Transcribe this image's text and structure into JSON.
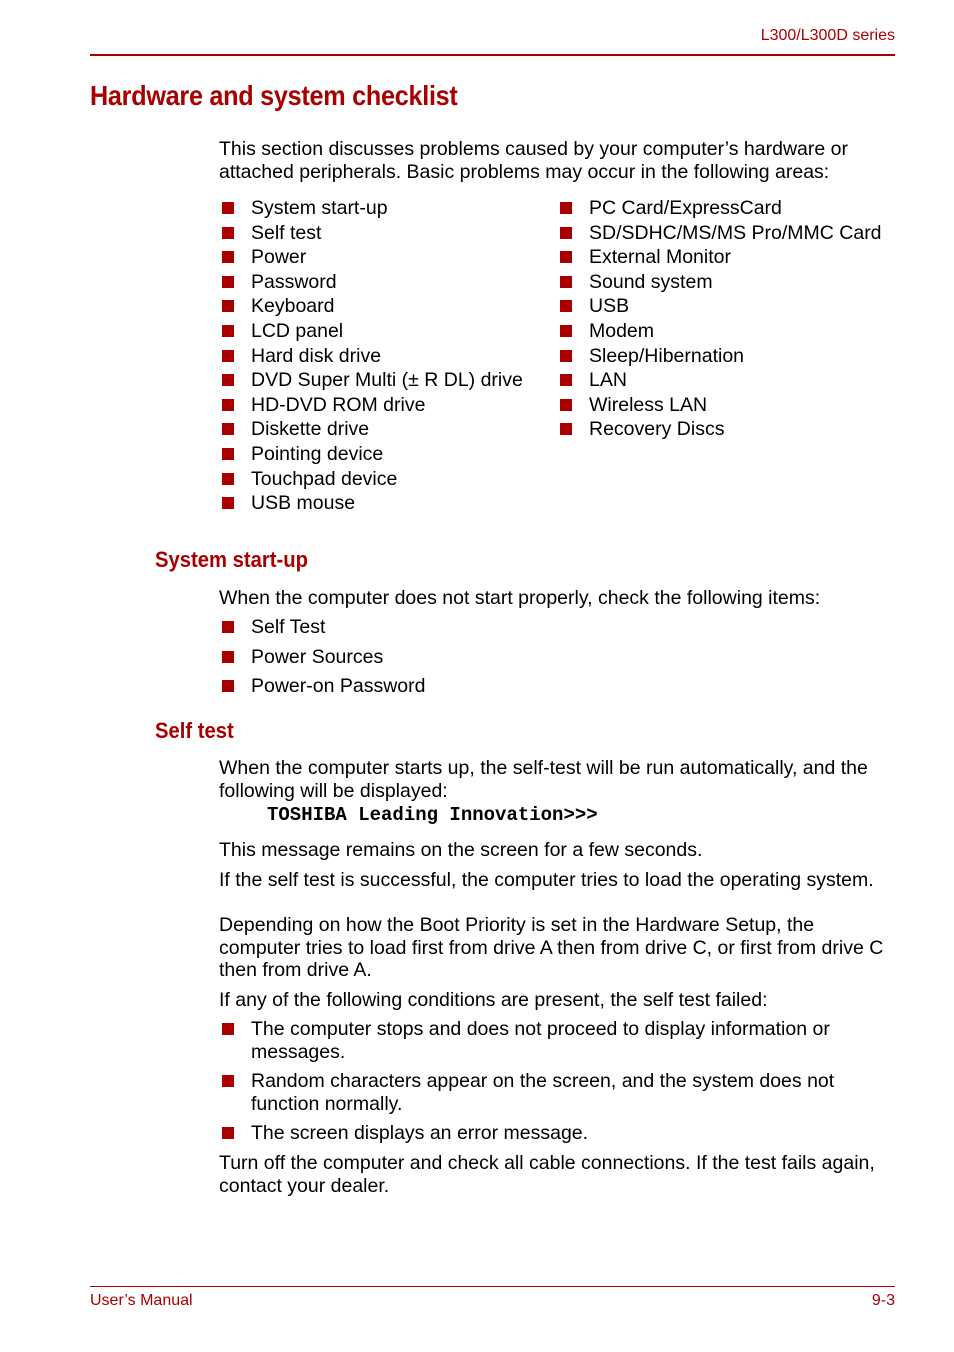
{
  "header": {
    "series": "L300/L300D series"
  },
  "title": "Hardware and system checklist",
  "intro": "This section discusses problems caused by your computer’s hardware or attached peripherals. Basic problems may occur in the following areas:",
  "areas_left": [
    "System start-up",
    "Self test",
    "Power",
    "Password",
    "Keyboard",
    "LCD panel",
    "Hard disk drive",
    "DVD Super Multi (± R DL) drive",
    "HD-DVD ROM drive",
    "Diskette drive",
    "Pointing device",
    "Touchpad device",
    "USB mouse"
  ],
  "areas_right": [
    "PC Card/ExpressCard",
    "SD/SDHC/MS/MS Pro/MMC Card",
    "External Monitor",
    "Sound system",
    "USB",
    "Modem",
    "Sleep/Hibernation",
    "LAN",
    "Wireless LAN",
    "Recovery Discs"
  ],
  "system_startup": {
    "heading": "System start-up",
    "text": "When the computer does not start properly, check the following items:",
    "items": [
      "Self Test",
      "Power Sources",
      "Power-on Password"
    ]
  },
  "self_test": {
    "heading": "Self test",
    "text": "When the computer starts up, the self-test will be run automatically, and the following will be displayed:",
    "display_message": "TOSHIBA Leading Innovation>>>",
    "p1": "This message remains on the screen for a few seconds.",
    "p2": "If the self test is successful, the computer tries to load the operating system.",
    "p3": "Depending on how the Boot Priority is set in the Hardware Setup, the computer tries to load first from drive A then from drive C, or first from drive C then from drive A.",
    "p4": "If any of the following conditions are present, the self test failed:",
    "conditions": [
      "The computer stops and does not proceed to display information or messages.",
      "Random characters appear on the screen, and the system does not function normally.",
      "The screen displays an error message."
    ],
    "p5": "Turn off the computer and check all cable connections. If the test fails again, contact your dealer."
  },
  "footer": {
    "left": "User’s Manual",
    "page": "9-3"
  },
  "colors": {
    "accent": "#a80000"
  }
}
